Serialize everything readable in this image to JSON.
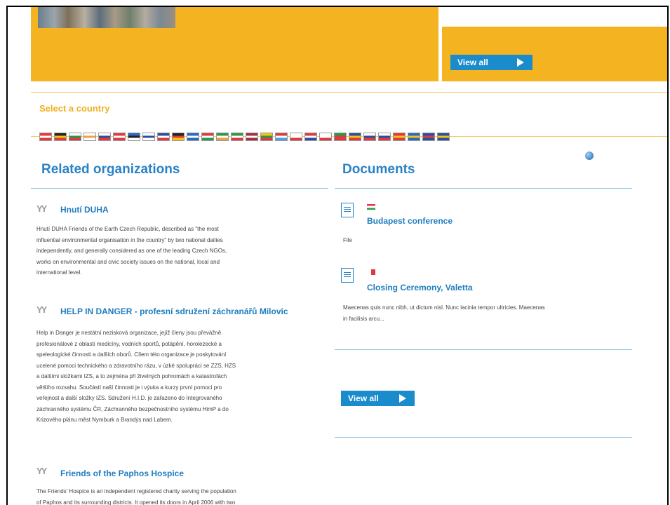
{
  "banner": {
    "view_all_label": "View all"
  },
  "countries": {
    "label": "Select a country",
    "flags": [
      {
        "name": "austria-flag",
        "colors": [
          "#e03a3e",
          "#ffffff",
          "#e03a3e"
        ]
      },
      {
        "name": "belgium-flag",
        "colors": [
          "#222222",
          "#f4c410",
          "#e03a3e"
        ]
      },
      {
        "name": "bulgaria-flag",
        "colors": [
          "#ffffff",
          "#2a9a4a",
          "#e03a3e"
        ]
      },
      {
        "name": "cyprus-flag",
        "colors": [
          "#ffffff",
          "#f0a040",
          "#ffffff"
        ]
      },
      {
        "name": "czech-flag",
        "colors": [
          "#ffffff",
          "#2a4fa0",
          "#e03a3e"
        ]
      },
      {
        "name": "denmark-flag",
        "colors": [
          "#e03a3e",
          "#ffffff",
          "#e03a3e"
        ]
      },
      {
        "name": "estonia-flag",
        "colors": [
          "#2a6ac0",
          "#222222",
          "#ffffff"
        ]
      },
      {
        "name": "finland-flag",
        "colors": [
          "#ffffff",
          "#2a4fa0",
          "#ffffff"
        ]
      },
      {
        "name": "france-flag",
        "colors": [
          "#2a4fa0",
          "#ffffff",
          "#e03a3e"
        ]
      },
      {
        "name": "germany-flag",
        "colors": [
          "#222222",
          "#e03a3e",
          "#f4c410"
        ]
      },
      {
        "name": "greece-flag",
        "colors": [
          "#2a6ac0",
          "#ffffff",
          "#2a6ac0"
        ]
      },
      {
        "name": "hungary-flag",
        "colors": [
          "#e03a3e",
          "#ffffff",
          "#2a9a4a"
        ]
      },
      {
        "name": "ireland-flag",
        "colors": [
          "#2a9a4a",
          "#ffffff",
          "#f0a040"
        ]
      },
      {
        "name": "italy-flag",
        "colors": [
          "#2a9a4a",
          "#ffffff",
          "#e03a3e"
        ]
      },
      {
        "name": "latvia-flag",
        "colors": [
          "#a03040",
          "#ffffff",
          "#a03040"
        ]
      },
      {
        "name": "lithuania-flag",
        "colors": [
          "#f4c410",
          "#2a9a4a",
          "#e03a3e"
        ]
      },
      {
        "name": "luxembourg-flag",
        "colors": [
          "#e03a3e",
          "#ffffff",
          "#4aa0e0"
        ]
      },
      {
        "name": "malta-flag",
        "colors": [
          "#ffffff",
          "#ffffff",
          "#e03a3e"
        ]
      },
      {
        "name": "netherlands-flag",
        "colors": [
          "#e03a3e",
          "#ffffff",
          "#2a4fa0"
        ]
      },
      {
        "name": "poland-flag",
        "colors": [
          "#ffffff",
          "#ffffff",
          "#e03a3e"
        ]
      },
      {
        "name": "portugal-flag",
        "colors": [
          "#2a9a4a",
          "#e03a3e",
          "#e03a3e"
        ]
      },
      {
        "name": "romania-flag",
        "colors": [
          "#2a4fa0",
          "#f4c410",
          "#e03a3e"
        ]
      },
      {
        "name": "slovakia-flag",
        "colors": [
          "#ffffff",
          "#2a4fa0",
          "#e03a3e"
        ]
      },
      {
        "name": "slovenia-flag",
        "colors": [
          "#ffffff",
          "#2a4fa0",
          "#e03a3e"
        ]
      },
      {
        "name": "spain-flag",
        "colors": [
          "#e03a3e",
          "#f4c410",
          "#e03a3e"
        ]
      },
      {
        "name": "sweden-flag",
        "colors": [
          "#2a6ac0",
          "#f4c410",
          "#2a6ac0"
        ]
      },
      {
        "name": "uk-flag",
        "colors": [
          "#2a4fa0",
          "#e03a3e",
          "#2a4fa0"
        ]
      },
      {
        "name": "eu-flag",
        "colors": [
          "#2a4fa0",
          "#f4c410",
          "#2a4fa0"
        ]
      }
    ]
  },
  "related": {
    "title": "Related organizations",
    "orgs": [
      {
        "name": "Hnutí DUHA",
        "lines": [
          "Hnutí DUHA Friends of the Earth Czech Republic, described as \"the most",
          "influential environmental organisation in the country\" by two national dailies",
          "independently, and generally considered as one of the leading Czech NGOs,",
          "works on environmental and civic society issues on the national, local and",
          "international level."
        ]
      },
      {
        "name": "HELP IN DANGER - profesní sdružení záchranářů Milovic",
        "lines": [
          "Help in Danger je nestátní nezisková organizace, jejíž členy jsou převážně",
          "profesionálové z oblasti medicíny, vodních sportů, potápění, horolezecké a",
          "speleologické činnosti a dalších oborů. Cílem této organizace je poskytování",
          "ucelené pomoci technického a zdravotního rázu, v úzké spolupráci se ZZS, HZS",
          "a dalšími složkami IZS, a to zejména při živelných pohromách a katastrofách",
          "většího rozsahu. Součástí naší činnosti je i výuka a kurzy první pomoci pro",
          "veřejnost a další složky IZS. Sdružení H.I.D. je zařazeno do Integrovaného",
          "záchranného systému ČR, Záchranného bezpečnostního systému HimP a do",
          "Krizového plánu měst Nymburk a Brandýs nad Labem."
        ]
      },
      {
        "name": "Friends of the Paphos Hospice",
        "lines": [
          "The Friends' Hospice is an independent registered charity serving the population",
          "of Paphos and its surrounding districts. It opened its doors in April 2006 with two"
        ]
      }
    ]
  },
  "documents": {
    "title": "Documents",
    "items": [
      {
        "title": "Budapest conference",
        "flag_colors": [
          "#e03a3e",
          "#ffffff",
          "#2a9a4a"
        ],
        "text": "File"
      },
      {
        "title": "Closing Ceremony, Valetta",
        "flag_colors": [
          "#ffffff",
          "#e03a3e"
        ],
        "lines": [
          "Maecenas quis nunc nibh, ut dictum nisl. Nunc lacinia tempor ultricies. Maecenas",
          "in facilisis arcu..."
        ]
      }
    ],
    "view_all_label": "View all"
  }
}
